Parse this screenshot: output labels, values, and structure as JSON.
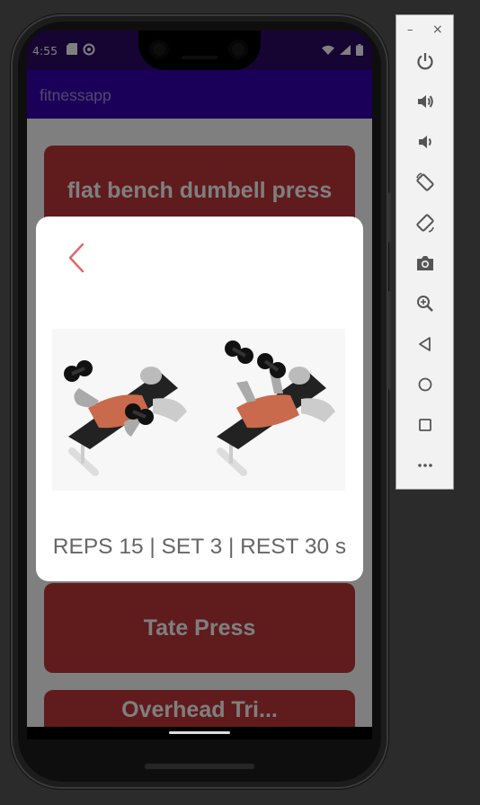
{
  "status_bar": {
    "time": "4:55"
  },
  "app": {
    "title": "fitnessapp"
  },
  "cards": [
    {
      "label": "flat bench dumbell press"
    },
    {
      "label": "Tate Press"
    },
    {
      "label": "Overhead Tri..."
    }
  ],
  "dialog": {
    "reps_text": "REPS 15 | SET 3 | REST 30 s"
  },
  "emulator": {
    "minimize_label": "–",
    "close_label": "×",
    "buttons": [
      {
        "icon": "power-icon"
      },
      {
        "icon": "volume-up-icon"
      },
      {
        "icon": "volume-down-icon"
      },
      {
        "icon": "rotate-left-icon"
      },
      {
        "icon": "rotate-right-icon"
      },
      {
        "icon": "camera-icon"
      },
      {
        "icon": "zoom-icon"
      },
      {
        "icon": "back-icon"
      },
      {
        "icon": "home-icon"
      },
      {
        "icon": "overview-icon"
      },
      {
        "icon": "more-icon"
      }
    ]
  },
  "colors": {
    "primary": "#3700b3",
    "status_bar": "#2d0a67",
    "card": "#c0373a",
    "back_arrow": "#e06666"
  }
}
